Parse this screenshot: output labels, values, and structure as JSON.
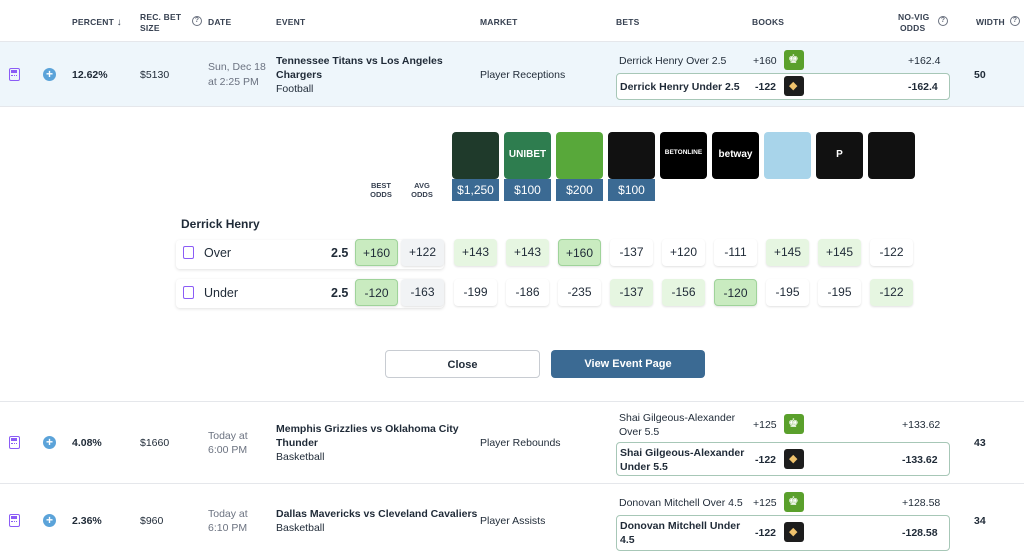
{
  "header": {
    "percent": "PERCENT",
    "rec_bet_1": "REC. BET",
    "rec_bet_2": "SIZE",
    "date": "DATE",
    "event": "EVENT",
    "market": "MARKET",
    "bets": "BETS",
    "books": "BOOKS",
    "novig_1": "NO-VIG",
    "novig_2": "ODDS",
    "width": "WIDTH",
    "sort_arrow": "↓",
    "help": "?"
  },
  "rows": [
    {
      "percent": "12.62%",
      "bet": "$5130",
      "date1": "Sun, Dec 18",
      "date2": "at 2:25 PM",
      "event1": "Tennessee Titans vs Los Angeles",
      "event2": "Chargers",
      "sport": "Football",
      "market": "Player Receptions",
      "bet_a": "Derrick Henry Over 2.5",
      "odds_a": "+160",
      "novig_a": "+162.4",
      "bet_b": "Derrick Henry Under 2.5",
      "odds_b": "-122",
      "novig_b": "-162.4",
      "width": "50"
    },
    {
      "percent": "4.08%",
      "bet": "$1660",
      "date1": "Today at",
      "date2": "6:00 PM",
      "event1": "Memphis Grizzlies vs Oklahoma City",
      "event2": "Thunder",
      "sport": "Basketball",
      "market": "Player Rebounds",
      "bet_a1": "Shai Gilgeous-Alexander",
      "bet_a2": "Over 5.5",
      "odds_a": "+125",
      "novig_a": "+133.62",
      "bet_b1": "Shai Gilgeous-Alexander",
      "bet_b2": "Under 5.5",
      "odds_b": "-122",
      "novig_b": "-133.62",
      "width": "43"
    },
    {
      "percent": "2.36%",
      "bet": "$960",
      "date1": "Today at",
      "date2": "6:10 PM",
      "event1": "Dallas Mavericks vs Cleveland Cavaliers",
      "event2": "",
      "sport": "Basketball",
      "market": "Player Assists",
      "bet_a": "Donovan Mitchell Over 4.5",
      "odds_a": "+125",
      "novig_a": "+128.58",
      "bet_b1": "Donovan Mitchell Under",
      "bet_b2": "4.5",
      "odds_b": "-122",
      "novig_b": "-128.58",
      "width": "34"
    }
  ],
  "detail": {
    "player": "Derrick Henry",
    "best_odds_1": "BEST",
    "best_odds_2": "ODDS",
    "avg_odds_1": "AVG",
    "avg_odds_2": "ODDS",
    "books": [
      {
        "name": "bet-mgm-icon",
        "label": "",
        "amount": "$1,250",
        "color": "#1f3a2b"
      },
      {
        "name": "unibet-icon",
        "label": "UNIBET",
        "amount": "$100",
        "color": "#2e7d4f"
      },
      {
        "name": "draftkings-icon",
        "label": "",
        "amount": "$200",
        "color": "#58a83a"
      },
      {
        "name": "fanduel-icon",
        "label": "",
        "amount": "$100",
        "color": "#111111"
      },
      {
        "name": "betonline-icon",
        "label": "BETONLINE",
        "amount": "",
        "color": "#000000"
      },
      {
        "name": "betway-icon",
        "label": "betway",
        "amount": "",
        "color": "#000000"
      },
      {
        "name": "bet-rivers-icon",
        "label": "",
        "amount": "",
        "color": "#a8d4ea"
      },
      {
        "name": "pointsbet-icon",
        "label": "P",
        "amount": "",
        "color": "#111111"
      },
      {
        "name": "fanduel-alt-icon",
        "label": "",
        "amount": "",
        "color": "#111111"
      }
    ],
    "over": {
      "label": "Over",
      "line": "2.5",
      "best": "+160",
      "avg": "+122",
      "odds": [
        "+143",
        "+143",
        "+160",
        "-137",
        "+120",
        "-111",
        "+145",
        "+145",
        "-122"
      ]
    },
    "under": {
      "label": "Under",
      "line": "2.5",
      "best": "-120",
      "avg": "-163",
      "odds": [
        "-199",
        "-186",
        "-235",
        "-137",
        "-156",
        "-120",
        "-195",
        "-195",
        "-122"
      ]
    },
    "close": "Close",
    "view": "View Event Page"
  }
}
